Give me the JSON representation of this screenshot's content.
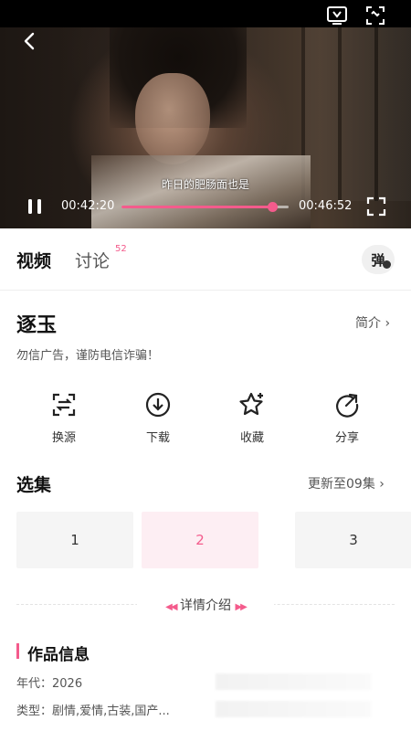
{
  "player": {
    "subtitle": "昨日的肥肠面也是",
    "current_time": "00:42:20",
    "total_time": "00:46:52",
    "progress": 0.9,
    "accent": "#f45b8c"
  },
  "tabs": {
    "video": "视频",
    "discuss": "讨论",
    "discuss_count": "52",
    "danmu": "弹"
  },
  "show": {
    "title": "逐玉",
    "intro_link": "简介 ›",
    "warning": "勿信广告，谨防电信诈骗！"
  },
  "actions": [
    {
      "label": "换源",
      "icon": "switch-source-icon"
    },
    {
      "label": "下载",
      "icon": "download-icon"
    },
    {
      "label": "收藏",
      "icon": "star-icon"
    },
    {
      "label": "分享",
      "icon": "share-icon"
    }
  ],
  "episodes": {
    "title": "选集",
    "update": "更新至09集 ›",
    "items": [
      "1",
      "2",
      "3"
    ],
    "active": "2"
  },
  "details": {
    "label": "详情介绍"
  },
  "info": {
    "title": "作品信息",
    "year": "年代：2026",
    "type": "类型：剧情,爱情,古装,国产..."
  }
}
